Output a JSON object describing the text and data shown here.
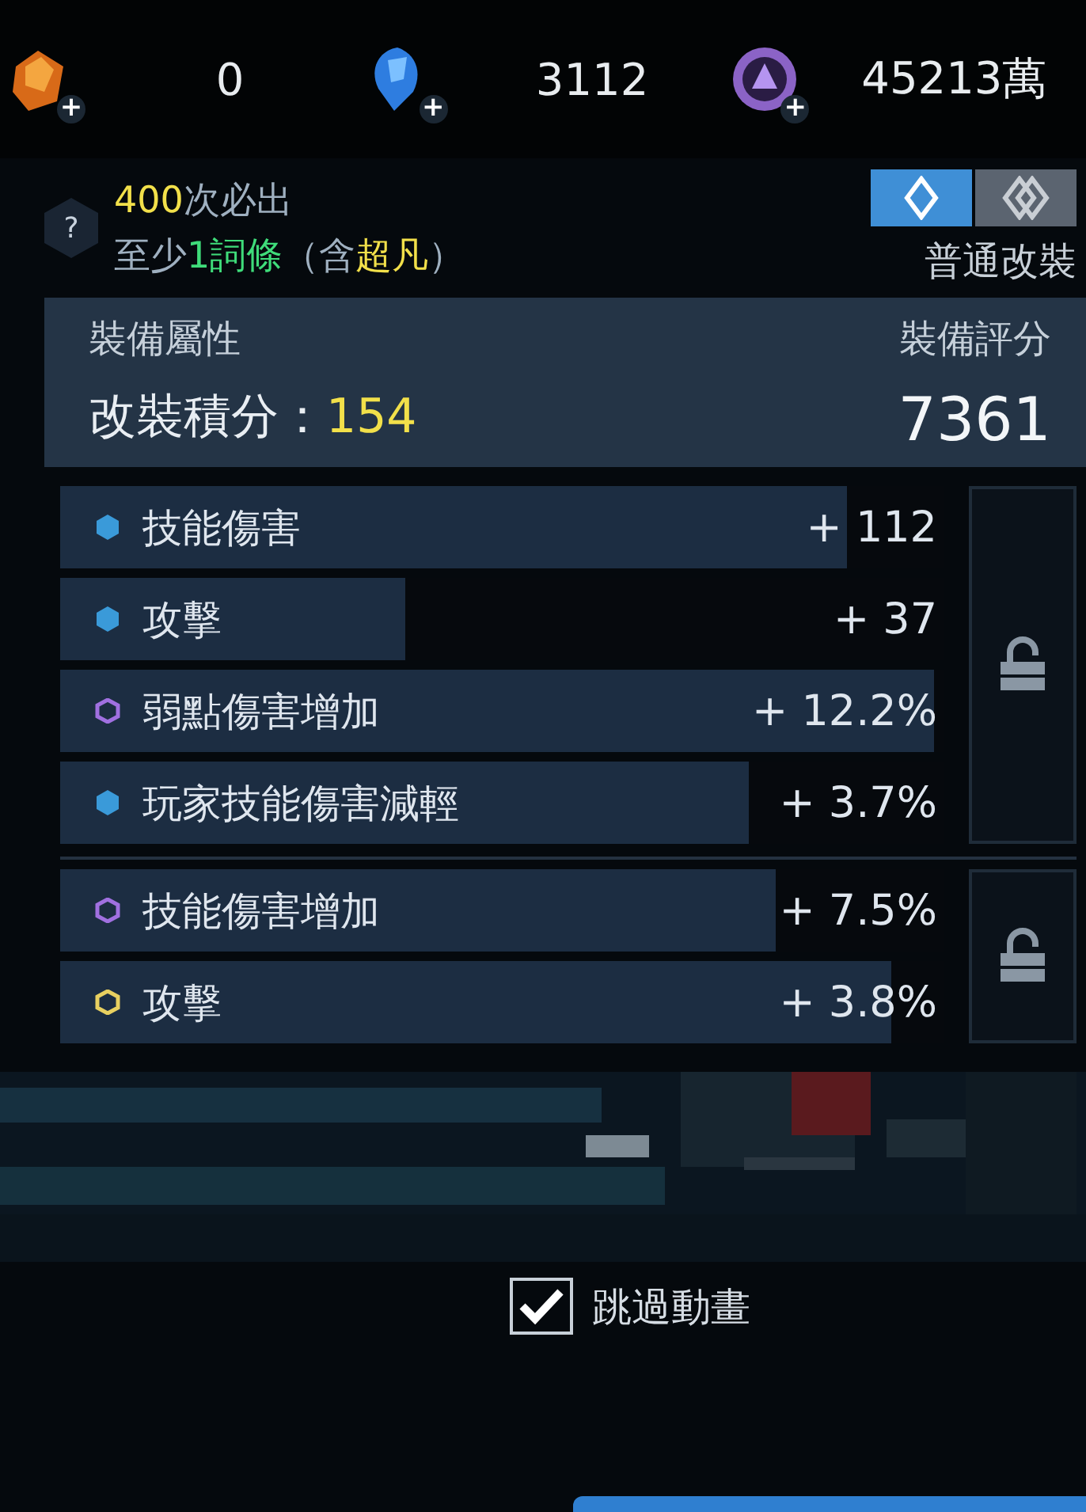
{
  "currencies": [
    {
      "kind": "amber",
      "amount": "0",
      "plus": "+"
    },
    {
      "kind": "sapphire",
      "amount": "3112",
      "plus": "+"
    },
    {
      "kind": "violet",
      "amount": "45213萬",
      "plus": "+"
    }
  ],
  "guarantee": {
    "help": "?",
    "line1": "**400**次必出",
    "line2": "至少**1詞條**（含**超凡**）"
  },
  "mode_tabs": [
    {
      "kind": "single",
      "selected": true
    },
    {
      "kind": "double",
      "selected": false
    }
  ],
  "mode_label": "普通改裝",
  "panel": {
    "title": "裝備屬性",
    "score_label": "裝備評分",
    "points_label": "改裝積分：",
    "points": "154",
    "score": "7361"
  },
  "groups": [
    {
      "locked": false,
      "stats": [
        {
          "name": "技能傷害",
          "value": "+ 112",
          "kind": "dot",
          "color": "#3a9ad9",
          "level": 0.89
        },
        {
          "name": "攻擊",
          "value": "+ 37",
          "kind": "dot",
          "color": "#3a9ad9",
          "level": 0.39
        },
        {
          "name": "弱點傷害增加",
          "value": "+ 12.2%",
          "kind": "hex",
          "color": "#a070e0",
          "level": 0.99
        },
        {
          "name": "玩家技能傷害減輕",
          "value": "+ 3.7%",
          "kind": "dot",
          "color": "#3a9ad9",
          "level": 0.78
        }
      ]
    },
    {
      "locked": false,
      "stats": [
        {
          "name": "技能傷害增加",
          "value": "+ 7.5%",
          "kind": "hex",
          "color": "#a070e0",
          "level": 0.81
        },
        {
          "name": "攻擊",
          "value": "+ 3.8%",
          "kind": "hex",
          "color": "#e8d060",
          "level": 0.94
        }
      ]
    }
  ],
  "skip_animation": {
    "label": "跳過動畫",
    "checked": true
  }
}
